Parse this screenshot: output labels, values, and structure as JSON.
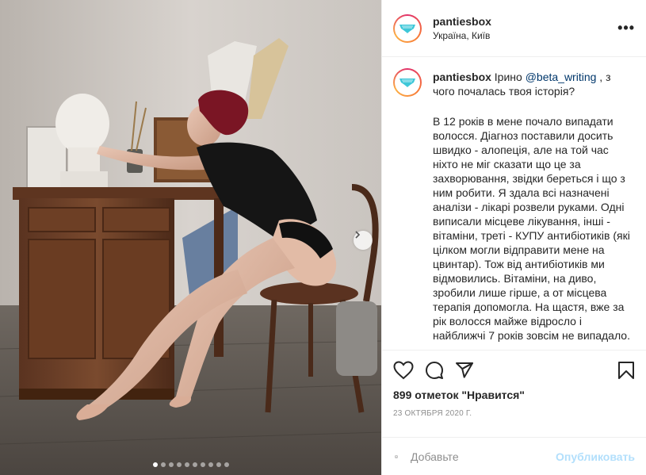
{
  "post": {
    "username": "pantiesbox",
    "location": "Україна, Київ",
    "more_label": "•••",
    "carousel": {
      "count": 10,
      "active_index": 0,
      "next_icon": "chevron-right-icon"
    }
  },
  "caption": {
    "username": "pantiesbox",
    "intro_before": "Ірино ",
    "mention": "@beta_writing",
    "intro_after": " , з чого почалась твоя історія?",
    "body": "В 12 років в мене почало випадати волосся. Діагноз поставили досить швидко - алопеція, але на той час ніхто не міг сказати що це за захворювання, звідки береться і що з ним робити. Я здала всі назначені аналізи - лікарі розвели руками. Одні виписали місцеве лікування, інші - вітаміни, треті - КУПУ антибіотиків (які цілком могли відправити мене на цвинтар). Тож від антибіотиків ми відмовились. Вітаміни, на диво, зробили лише гірше, а от місцева терапія допомогла. На щастя, вже за рік волосся майже відросло і найближчі 7 років зовсім не випадало."
  },
  "actions": {
    "icons": [
      "heart-icon",
      "comment-icon",
      "share-icon",
      "bookmark-icon"
    ],
    "likes": "899 отметок \"Нравится\"",
    "date": "23 ОКТЯБРЯ 2020 Г."
  },
  "comment_box": {
    "placeholder": "Добавьте",
    "emoji_icon": "smiley-icon",
    "publish_label": "Опубликовать"
  },
  "colors": {
    "link": "#00376b",
    "publish_disabled": "#b2dffc",
    "muted": "#8e8e8e",
    "logo_teal": "#3ec7d8"
  }
}
